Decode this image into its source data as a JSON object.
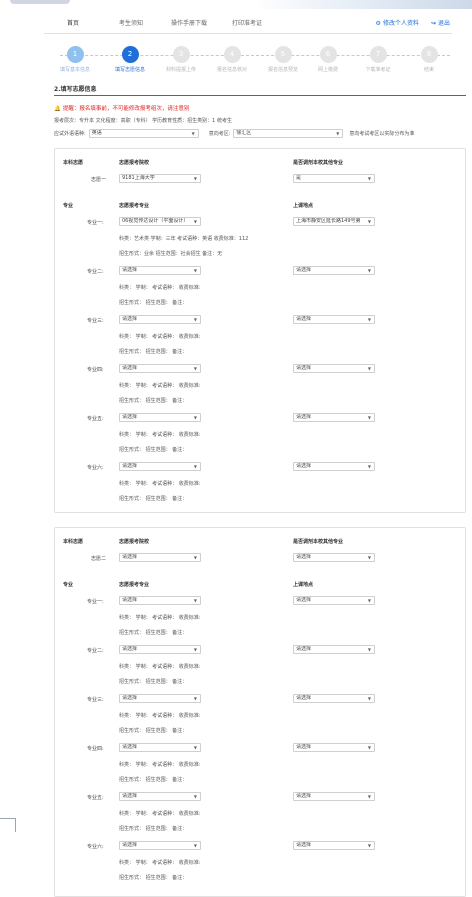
{
  "nav": {
    "items": [
      "首页",
      "考生须知",
      "操作手册下载",
      "打印准考证"
    ],
    "right": [
      {
        "icon": "⚙",
        "label": "修改个人资料"
      },
      {
        "icon": "↪",
        "label": "退出"
      }
    ]
  },
  "steps": [
    {
      "num": "1",
      "label": "填写基本信息",
      "state": "done"
    },
    {
      "num": "2",
      "label": "填写志愿信息",
      "state": "current"
    },
    {
      "num": "3",
      "label": "材料提报上传",
      "state": "todo"
    },
    {
      "num": "4",
      "label": "报名信息核对",
      "state": "todo"
    },
    {
      "num": "5",
      "label": "报名信息预览",
      "state": "todo"
    },
    {
      "num": "6",
      "label": "网上缴费",
      "state": "todo"
    },
    {
      "num": "7",
      "label": "下载准考证",
      "state": "todo"
    },
    {
      "num": "8",
      "label": "结束",
      "state": "todo"
    }
  ],
  "section_title": "2.填写志愿信息",
  "warning": "提醒：报名填事前，不可能修改报考组次，请注意别",
  "info_line": "报考层次：专升本  文化程度：高职（专科） 学历教育性质：招生类别：1 统考生",
  "filter": {
    "lang_label": "应试外语语种:",
    "lang_value": "英语",
    "area_label": "意向考区:",
    "area_value": "徐汇区",
    "note": "意向考试考区以实际分布为准"
  },
  "card1": {
    "section_label": "本科志愿",
    "school_header": "志愿报考院校",
    "adjust_header": "是否调剂本校其他专业",
    "wish_label": "志愿一",
    "school_value": "9181上海大学",
    "adjust_value": "是",
    "major_section_label": "专业",
    "major_header": "志愿报考专业",
    "location_header": "上课地点",
    "majors": [
      {
        "label": "专业一:",
        "value": "06视觉传达设计（平面设计）",
        "location": "上海市静安区延长路149号第",
        "detail1": "科类：艺术类  学制：三年  考试语种：英语  收费标准：112",
        "detail2": "招生形式：业余  招生范围：社会招生  备注：无"
      },
      {
        "label": "专业二:",
        "value": "请选择",
        "location": "请选择",
        "detail1": "科类：  学制：  考试语种：  收费标准:",
        "detail2": "招生形式：  招生范围：  备注："
      },
      {
        "label": "专业三:",
        "value": "请选择",
        "location": "请选择",
        "detail1": "科类：  学制：  考试语种：  收费标准:",
        "detail2": "招生形式：  招生范围：  备注："
      },
      {
        "label": "专业四:",
        "value": "请选择",
        "location": "请选择",
        "detail1": "科类：  学制：  考试语种：  收费标准:",
        "detail2": "招生形式：  招生范围：  备注："
      },
      {
        "label": "专业五:",
        "value": "请选择",
        "location": "请选择",
        "detail1": "科类：  学制：  考试语种：  收费标准:",
        "detail2": "招生形式：  招生范围：  备注："
      },
      {
        "label": "专业六:",
        "value": "请选择",
        "location": "请选择",
        "detail1": "科类：  学制：  考试语种：  收费标准:",
        "detail2": "招生形式：  招生范围：  备注："
      }
    ]
  },
  "card2": {
    "section_label": "本科志愿",
    "school_header": "志愿报考院校",
    "adjust_header": "是否调剂本校其他专业",
    "wish_label": "志愿二",
    "school_value": "请选择",
    "adjust_value": "请选择",
    "major_section_label": "专业",
    "major_header": "志愿报考专业",
    "location_header": "上课地点",
    "majors": [
      {
        "label": "专业一:",
        "value": "请选择",
        "location": "请选择",
        "detail1": "科类：  学制：  考试语种：  收费标准:",
        "detail2": "招生形式：  招生范围：  备注："
      },
      {
        "label": "专业二:",
        "value": "请选择",
        "location": "请选择",
        "detail1": "科类：  学制：  考试语种：  收费标准:",
        "detail2": "招生形式：  招生范围：  备注："
      },
      {
        "label": "专业三:",
        "value": "请选择",
        "location": "请选择",
        "detail1": "科类：  学制：  考试语种：  收费标准:",
        "detail2": "招生形式：  招生范围：  备注："
      },
      {
        "label": "专业四:",
        "value": "请选择",
        "location": "请选择",
        "detail1": "科类：  学制：  考试语种：  收费标准:",
        "detail2": "招生形式：  招生范围：  备注："
      },
      {
        "label": "专业五:",
        "value": "请选择",
        "location": "请选择",
        "detail1": "科类：  学制：  考试语种：  收费标准:",
        "detail2": "招生形式：  招生范围：  备注："
      },
      {
        "label": "专业六:",
        "value": "请选择",
        "location": "请选择",
        "detail1": "科类：  学制：  考试语种：  收费标准:",
        "detail2": "招生形式：  招生范围：  备注："
      }
    ]
  },
  "colors": {
    "accent": "#1e6fd9",
    "warning": "#e02020"
  }
}
